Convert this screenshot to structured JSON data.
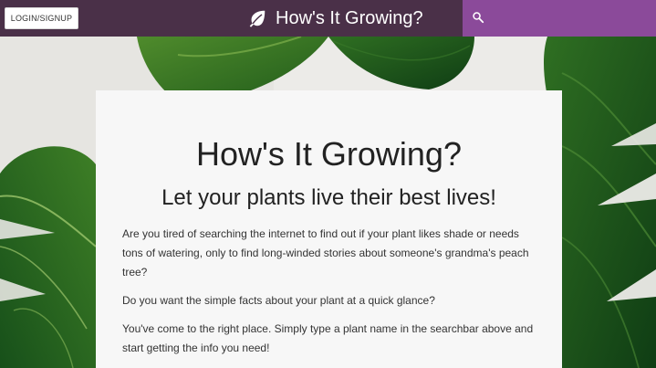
{
  "navbar": {
    "login_label": "LOGIN/SIGNUP",
    "brand_title": "How's It Growing?",
    "brand_icon": "leaf-icon",
    "search_icon": "search-icon",
    "search_placeholder": "",
    "colors": {
      "navbar_bg": "#4a3048",
      "search_bg": "#8b4a9a"
    }
  },
  "hero": {
    "title": "How's It Growing?",
    "tagline": "Let your plants live their best lives!",
    "paragraphs": [
      "Are you tired of searching the internet to find out if your plant likes shade or needs tons of watering, only to find long-winded stories about someone's grandma's peach tree?",
      "Do you want the simple facts about your plant at a quick glance?",
      "You've come to the right place. Simply type a plant name in the searchbar above and start getting the info you need!"
    ]
  }
}
